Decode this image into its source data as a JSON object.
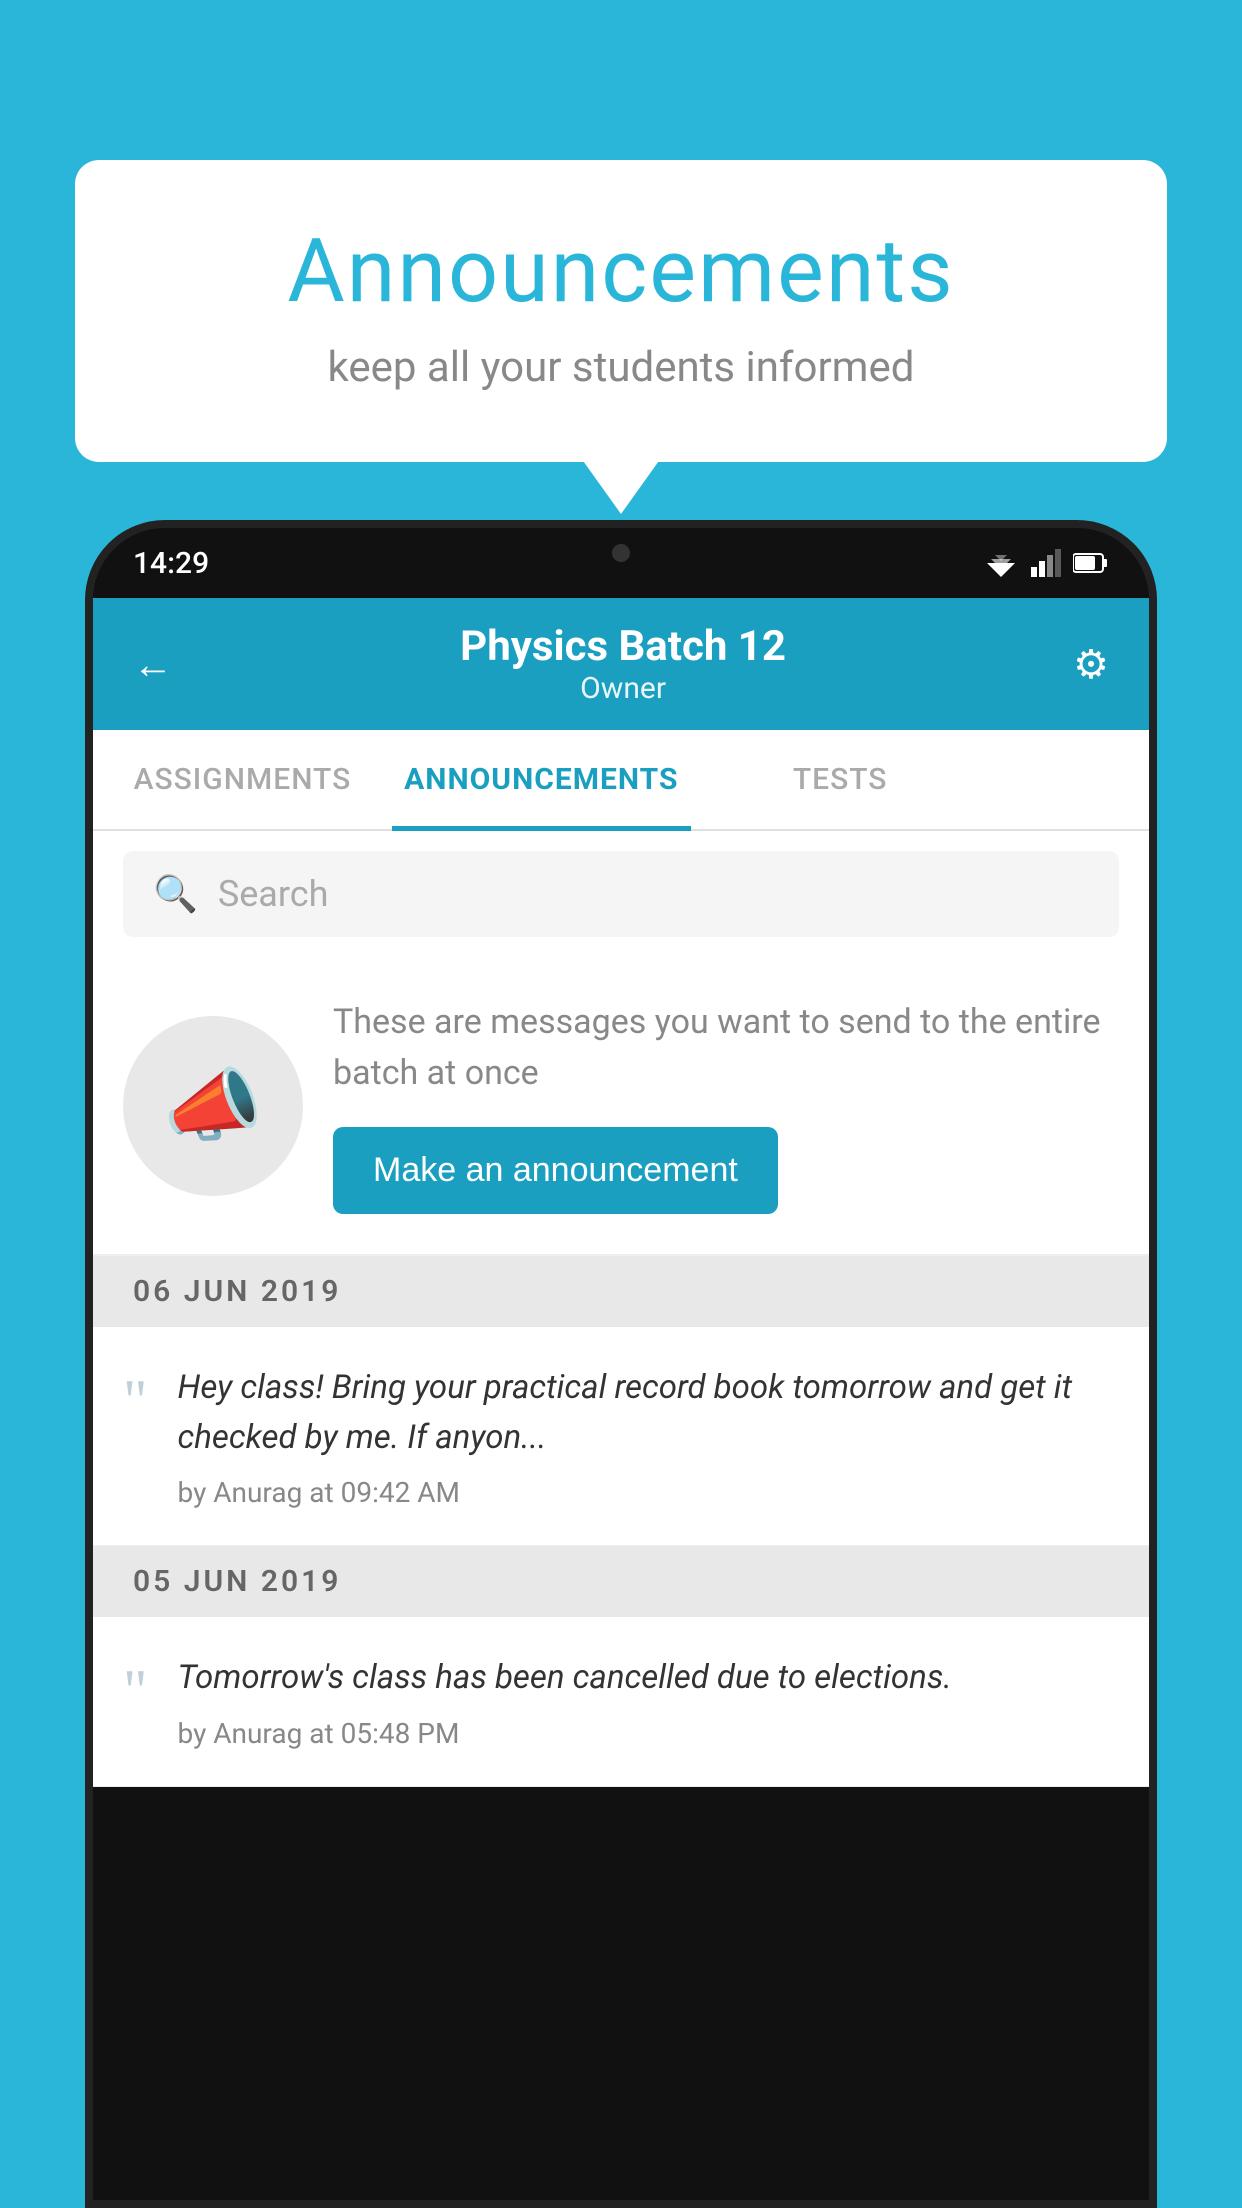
{
  "page": {
    "background_color": "#29b6d8"
  },
  "speech_bubble": {
    "title": "Announcements",
    "subtitle": "keep all your students informed"
  },
  "phone": {
    "status_bar": {
      "time": "14:29"
    },
    "header": {
      "batch_name": "Physics Batch 12",
      "owner_label": "Owner",
      "back_label": "←",
      "settings_label": "⚙"
    },
    "tabs": [
      {
        "label": "ASSIGNMENTS",
        "active": false
      },
      {
        "label": "ANNOUNCEMENTS",
        "active": true
      },
      {
        "label": "TESTS",
        "active": false
      },
      {
        "label": "",
        "active": false,
        "partial": true
      }
    ],
    "search": {
      "placeholder": "Search"
    },
    "announcement_prompt": {
      "description": "These are messages you want to send to the entire batch at once",
      "button_label": "Make an announcement"
    },
    "announcements": [
      {
        "date": "06  JUN  2019",
        "items": [
          {
            "text": "Hey class! Bring your practical record book tomorrow and get it checked by me. If anyon...",
            "meta": "by Anurag at 09:42 AM"
          }
        ]
      },
      {
        "date": "05  JUN  2019",
        "items": [
          {
            "text": "Tomorrow's class has been cancelled due to elections.",
            "meta": "by Anurag at 05:48 PM"
          }
        ]
      }
    ]
  }
}
